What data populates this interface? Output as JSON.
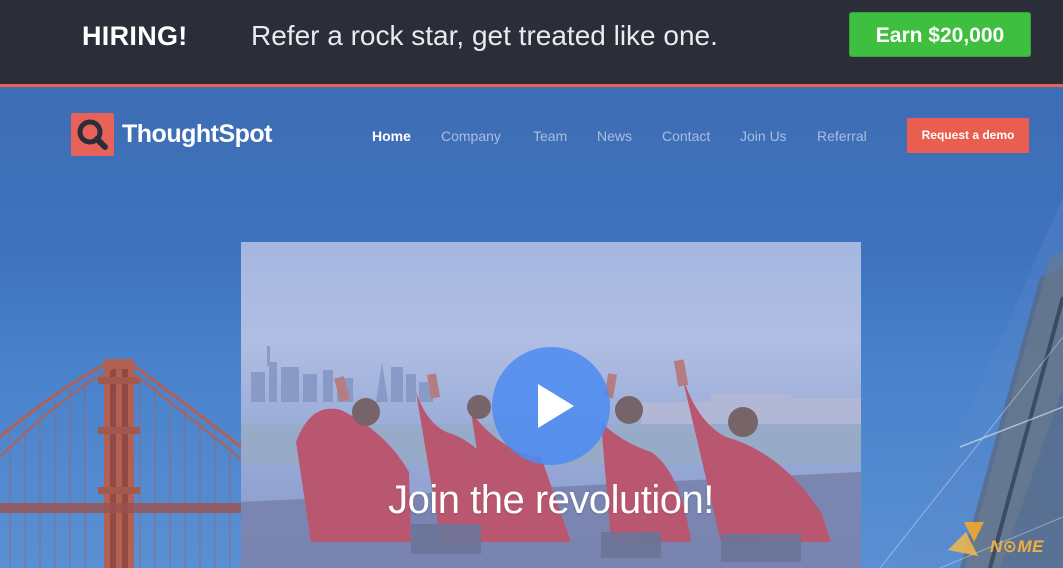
{
  "banner": {
    "hiring": "HIRING!",
    "tagline": "Refer a rock star, get treated like one.",
    "cta": "Earn $20,000"
  },
  "brand": {
    "name": "ThoughtSpot",
    "accent": "#e8625a"
  },
  "nav": {
    "items": [
      {
        "label": "Home",
        "active": true
      },
      {
        "label": "Company"
      },
      {
        "label": "Team"
      },
      {
        "label": "News"
      },
      {
        "label": "Contact"
      },
      {
        "label": "Join Us"
      },
      {
        "label": "Referral"
      }
    ],
    "demo_button": "Request a demo"
  },
  "video": {
    "caption": "Join the revolution!"
  },
  "watermark": {
    "text": "N⊙ME"
  },
  "colors": {
    "banner_bg": "#2b2e38",
    "banner_cta": "#3fbf3f",
    "hero_bg": "#3f73bf",
    "demo_button": "#ea5e4f",
    "play_button": "#4e8cf0"
  }
}
